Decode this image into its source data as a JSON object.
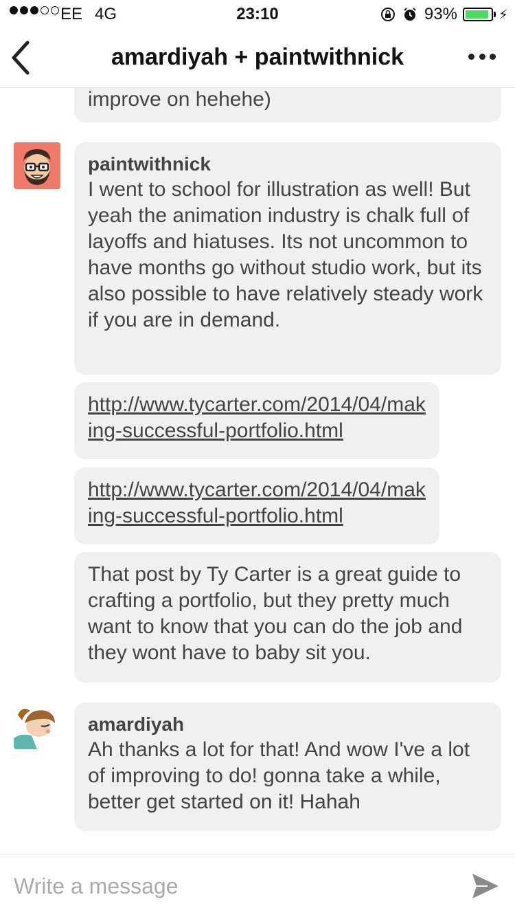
{
  "status_bar": {
    "carrier": "EE",
    "network": "4G",
    "time": "23:10",
    "battery": "93%",
    "battery_level": 0.93
  },
  "nav": {
    "title": "amardiyah + paintwithnick"
  },
  "messages": {
    "partial_top": "improve on hehehe)",
    "nick_name": "paintwithnick",
    "nick_message": "I went to school for illustration as well! But yeah the animation industry is chalk full of layoffs and hiatuses. Its not uncommon to have months go without studio work, but its also possible to have relatively steady work if you are in demand.",
    "link_1": "http://www.tycarter.com/2014/04/making-successful-portfolio.html",
    "link_2": "http://www.tycarter.com/2014/04/making-successful-portfolio.html",
    "nick_message_2": "That post by Ty Carter is a great guide to crafting a portfolio, but they pretty much want to know that you can do the job and they wont have to baby sit you.",
    "amardiyah_name": "amardiyah",
    "amardiyah_message": "Ah thanks a lot for that! And wow I've a lot of improving to do! gonna take a while, better get started on it! Hahah"
  },
  "compose": {
    "placeholder": "Write a message"
  },
  "colors": {
    "bubble": "#f0f0f0",
    "battery_fill": "#4cd964",
    "avatar_bg": "#f07a6a"
  }
}
